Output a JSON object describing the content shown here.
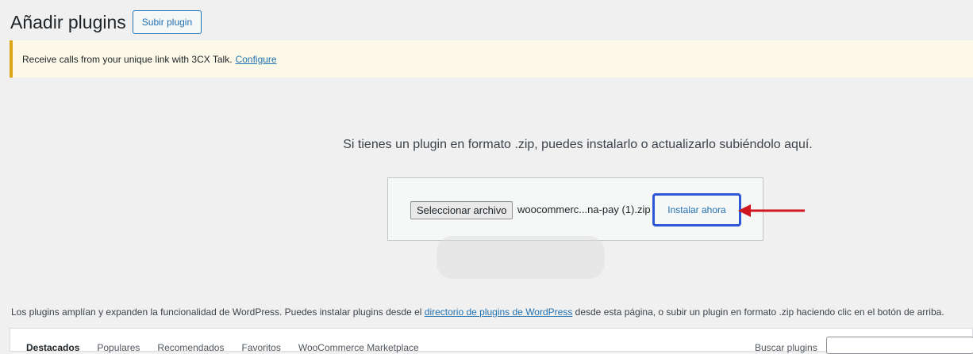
{
  "header": {
    "title": "Añadir plugins",
    "upload_button": "Subir plugin"
  },
  "notice": {
    "text": "Receive calls from your unique link with 3CX Talk.",
    "link": "Configure",
    "accent_color": "#dba617"
  },
  "upload": {
    "intro": "Si tienes un plugin en formato .zip, puedes instalarlo o actualizarlo subiéndolo aquí.",
    "file_button": "Seleccionar archivo",
    "file_name": "woocommerc...na-pay (1).zip",
    "install_button": "Instalar ahora",
    "highlight_color": "#2f56d4",
    "arrow_color": "#d0161e"
  },
  "description": {
    "before": "Los plugins amplían y expanden la funcionalidad de WordPress. Puedes instalar plugins desde el ",
    "link": "directorio de plugins de WordPress",
    "after": " desde esta página, o subir un plugin en formato .zip haciendo clic en el botón de arriba."
  },
  "filters": {
    "items": [
      "Destacados",
      "Populares",
      "Recomendados",
      "Favoritos",
      "WooCommerce Marketplace"
    ],
    "search_label": "Buscar plugins"
  }
}
